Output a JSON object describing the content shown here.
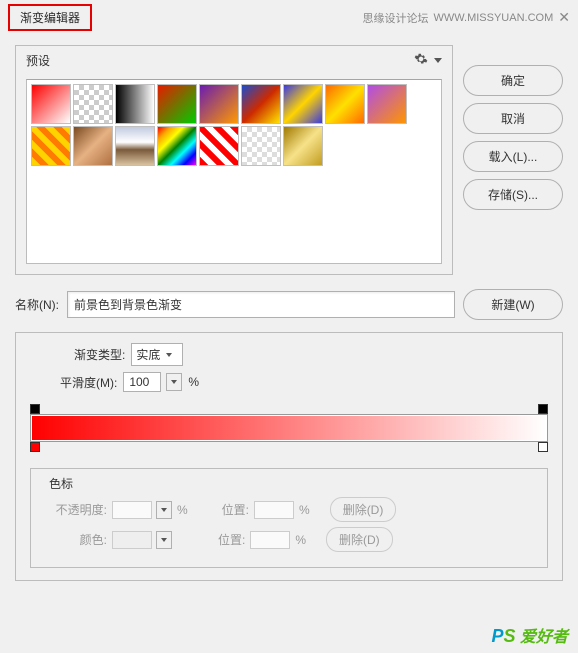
{
  "dialog": {
    "title": "渐变编辑器"
  },
  "credits": {
    "forum": "思缘设计论坛",
    "site": "WWW.MISSYUAN.COM"
  },
  "presets": {
    "header": "预设",
    "gear_icon": "gear-icon"
  },
  "buttons": {
    "ok": "确定",
    "cancel": "取消",
    "load": "载入(L)...",
    "save": "存储(S)...",
    "new": "新建(W)"
  },
  "name": {
    "label": "名称(N):",
    "value": "前景色到背景色渐变"
  },
  "gradient": {
    "type_label": "渐变类型:",
    "type_value": "实底",
    "smooth_label": "平滑度(M):",
    "smooth_value": "100",
    "smooth_unit": "%"
  },
  "stops": {
    "header": "色标",
    "opacity_label": "不透明度:",
    "opacity_unit": "%",
    "position_label": "位置:",
    "position_unit": "%",
    "delete_label": "删除(D)",
    "color_label": "颜色:"
  },
  "watermark": {
    "p": "P",
    "s": "S",
    "cn": " 爱好者"
  }
}
